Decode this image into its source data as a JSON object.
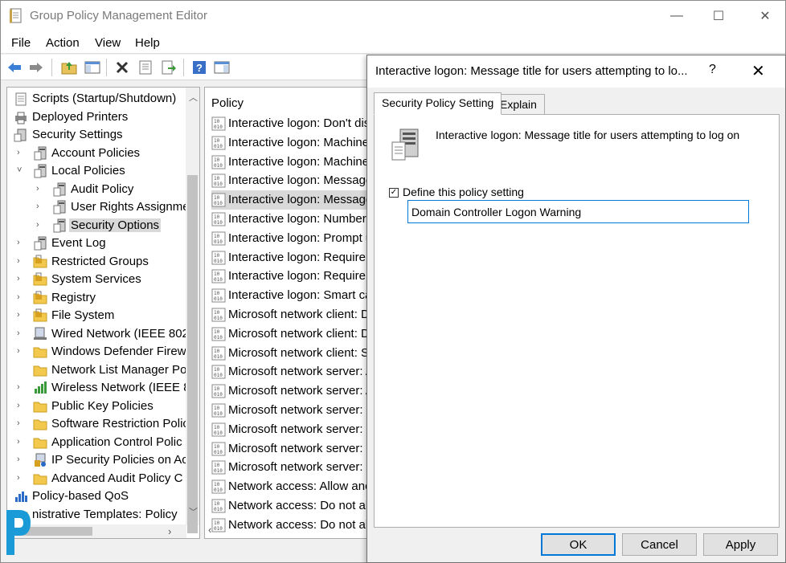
{
  "window": {
    "title": "Group Policy Management Editor",
    "controls": {
      "minimize": "—",
      "maximize": "☐",
      "close": "✕"
    }
  },
  "menu": [
    "File",
    "Action",
    "View",
    "Help"
  ],
  "toolbar": {
    "buttons": [
      "back-icon",
      "forward-icon",
      "up-folder-icon",
      "show-hide-tree-icon",
      "delete-icon",
      "properties-icon",
      "export-icon",
      "help-icon",
      "console-icon"
    ]
  },
  "tree": {
    "items": [
      {
        "label": "Scripts (Startup/Shutdown)",
        "icon": "script-icon"
      },
      {
        "label": "Deployed Printers",
        "icon": "printer-icon"
      },
      {
        "label": "Security Settings",
        "icon": "security-icon"
      },
      {
        "label": "Account Policies",
        "icon": "policy-icon",
        "expander": "›"
      },
      {
        "label": "Local Policies",
        "icon": "policy-icon",
        "expander": "˅"
      },
      {
        "label": "Audit Policy",
        "icon": "policy-icon",
        "expander": "›"
      },
      {
        "label": "User Rights Assignme",
        "icon": "policy-icon",
        "expander": "›"
      },
      {
        "label": "Security Options",
        "icon": "policy-icon",
        "expander": "›"
      },
      {
        "label": "Event Log",
        "icon": "policy-icon",
        "expander": "›"
      },
      {
        "label": "Restricted Groups",
        "icon": "folder-lock-icon",
        "expander": "›"
      },
      {
        "label": "System Services",
        "icon": "folder-lock-icon",
        "expander": "›"
      },
      {
        "label": "Registry",
        "icon": "folder-lock-icon",
        "expander": "›"
      },
      {
        "label": "File System",
        "icon": "folder-lock-icon",
        "expander": "›"
      },
      {
        "label": "Wired Network (IEEE 802",
        "icon": "network-icon",
        "expander": "›"
      },
      {
        "label": "Windows Defender Firew",
        "icon": "folder-icon",
        "expander": "›"
      },
      {
        "label": "Network List Manager Po",
        "icon": "folder-icon",
        "expander": ""
      },
      {
        "label": "Wireless Network (IEEE 8",
        "icon": "wireless-icon",
        "expander": "›"
      },
      {
        "label": "Public Key Policies",
        "icon": "folder-icon",
        "expander": "›"
      },
      {
        "label": "Software Restriction Polic",
        "icon": "folder-icon",
        "expander": "›"
      },
      {
        "label": "Application Control Polic",
        "icon": "folder-icon",
        "expander": "›"
      },
      {
        "label": "IP Security Policies on Ac",
        "icon": "ipsec-icon",
        "expander": "›"
      },
      {
        "label": "Advanced Audit Policy C",
        "icon": "folder-icon",
        "expander": "›"
      },
      {
        "label": "Policy-based QoS",
        "icon": "qos-icon",
        "expander": ""
      },
      {
        "label": "nistrative Templates: Policy",
        "icon": "folder-icon",
        "expander": ""
      }
    ]
  },
  "list": {
    "header": "Policy",
    "items": [
      "Interactive logon: Don't dis",
      "Interactive logon: Machine",
      "Interactive logon: Machine",
      "Interactive logon: Message",
      "Interactive logon: Message",
      "Interactive logon: Number",
      "Interactive logon: Prompt u",
      "Interactive logon: Require D",
      "Interactive logon: Require W",
      "Interactive logon: Smart car",
      "Microsoft network client: D",
      "Microsoft network client: D",
      "Microsoft network client: Se",
      "Microsoft network server: A",
      "Microsoft network server: A",
      "Microsoft network server: D",
      "Microsoft network server: D",
      "Microsoft network server: D",
      "Microsoft network server: S",
      "Network access: Allow anor",
      "Network access: Do not allo",
      "Network access: Do not allo"
    ]
  },
  "dialog": {
    "title": "Interactive logon: Message title for users attempting to lo...",
    "help": "?",
    "close": "✕",
    "tabs": [
      "Security Policy Setting",
      "Explain"
    ],
    "policy_title": "Interactive logon: Message title for users attempting to log on",
    "define_label": "Define this policy setting",
    "define_checked": true,
    "value": "Domain Controller Logon Warning",
    "buttons": {
      "ok": "OK",
      "cancel": "Cancel",
      "apply": "Apply"
    }
  },
  "colors": {
    "accent": "#0078d7",
    "selection": "#d9d9d9",
    "folder": "#f2c94c"
  }
}
